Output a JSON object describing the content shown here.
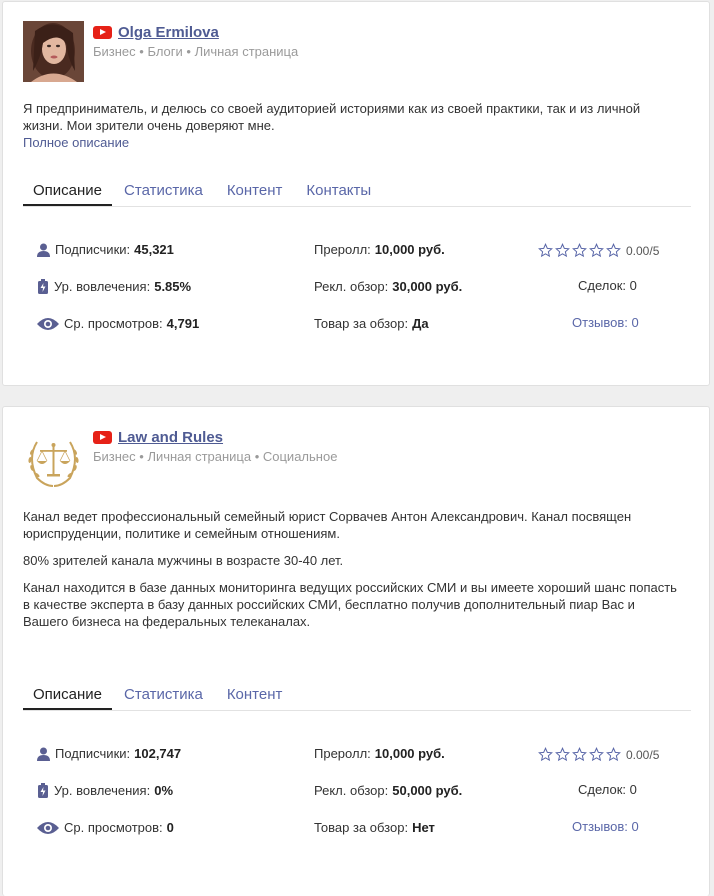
{
  "channels": [
    {
      "name": "Olga Ermilova",
      "platform_icon": "youtube-icon",
      "categories": "Бизнес • Блоги • Личная страница",
      "description": [
        "Я предприниматель, и делюсь со своей аудиторией историями как из своей практики, так и из личной жизни. Мои зрители очень доверяют мне."
      ],
      "more_link": "Полное описание",
      "tabs": [
        "Описание",
        "Статистика",
        "Контент",
        "Контакты"
      ],
      "active_tab": "Описание",
      "stats": {
        "subscribers_label": "Подписчики:",
        "subscribers": "45,321",
        "engagement_label": "Ур. вовлечения:",
        "engagement": "5.85%",
        "views_label": "Ср. просмотров:",
        "views": "4,791",
        "preroll_label": "Преролл:",
        "preroll": "10,000 руб.",
        "review_label": "Рекл. обзор:",
        "review": "30,000 руб.",
        "product_label": "Товар за обзор:",
        "product": "Да",
        "rating": "0.00/5",
        "deals": "Сделок: 0",
        "reviews": "Отзывов: 0"
      }
    },
    {
      "name": "Law and Rules",
      "platform_icon": "youtube-icon",
      "categories": "Бизнес • Личная страница • Социальное",
      "description": [
        "Канал ведет профессиональный семейный юрист Сорвачев Антон Александрович. Канал посвящен юриспруденции, политике и семейным отношениям.",
        "80% зрителей канала мужчины в возрасте 30-40 лет.",
        "Канал находится в базе данных мониторинга ведущих российских СМИ и  вы имеете хороший шанс попасть в качестве эксперта в базу данных российских СМИ, бесплатно получив дополнительный пиар Вас и Вашего бизнеса на федеральных телеканалах."
      ],
      "tabs": [
        "Описание",
        "Статистика",
        "Контент"
      ],
      "active_tab": "Описание",
      "stats": {
        "subscribers_label": "Подписчики:",
        "subscribers": "102,747",
        "engagement_label": "Ур. вовлечения:",
        "engagement": "0%",
        "views_label": "Ср. просмотров:",
        "views": "0",
        "preroll_label": "Преролл:",
        "preroll": "10,000 руб.",
        "review_label": "Рекл. обзор:",
        "review": "50,000 руб.",
        "product_label": "Товар за обзор:",
        "product": "Нет",
        "rating": "0.00/5",
        "deals": "Сделок: 0",
        "reviews": "Отзывов: 0"
      }
    }
  ],
  "colors": {
    "accent": "#5a67a8",
    "link": "#4f5b93",
    "youtube": "#e62117",
    "gold": "#c9a45c"
  }
}
